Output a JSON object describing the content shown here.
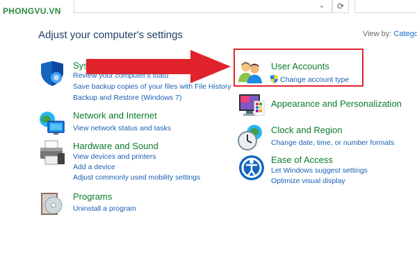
{
  "watermark": "PHONGVU.VN",
  "topbar": {
    "dropdown_glyph": "⌄",
    "refresh_glyph": "⟳"
  },
  "page_title": "Adjust your computer's settings",
  "view_by": {
    "label": "View by:",
    "value": "Catego"
  },
  "categories": {
    "system": {
      "title": "Syst",
      "links": [
        "Review your computer's statu",
        "Save backup copies of your files with File History",
        "Backup and Restore (Windows 7)"
      ],
      "icon": "system-security-icon"
    },
    "network": {
      "title": "Network and Internet",
      "links": [
        "View network status and tasks"
      ],
      "icon": "network-globe-icon"
    },
    "hardware": {
      "title": "Hardware and Sound",
      "links": [
        "View devices and printers",
        "Add a device",
        "Adjust commonly used mobility settings"
      ],
      "icon": "printer-icon"
    },
    "programs": {
      "title": "Programs",
      "links": [
        "Uninstall a program"
      ],
      "icon": "programs-disk-icon"
    },
    "user_accounts": {
      "title": "User Accounts",
      "links": [
        "Change account type"
      ],
      "icon": "users-icon"
    },
    "appearance": {
      "title": "Appearance and Personalization",
      "links": [],
      "icon": "monitor-palette-icon"
    },
    "clock": {
      "title": "Clock and Region",
      "links": [
        "Change date, time, or number formats"
      ],
      "icon": "clock-globe-icon"
    },
    "ease": {
      "title": "Ease of Access",
      "links": [
        "Let Windows suggest settings",
        "Optimize visual display"
      ],
      "icon": "ease-of-access-icon"
    }
  },
  "colors": {
    "category_title": "#0a7a2c",
    "link": "#1a5fb4",
    "annotation_red": "#e0232b"
  }
}
